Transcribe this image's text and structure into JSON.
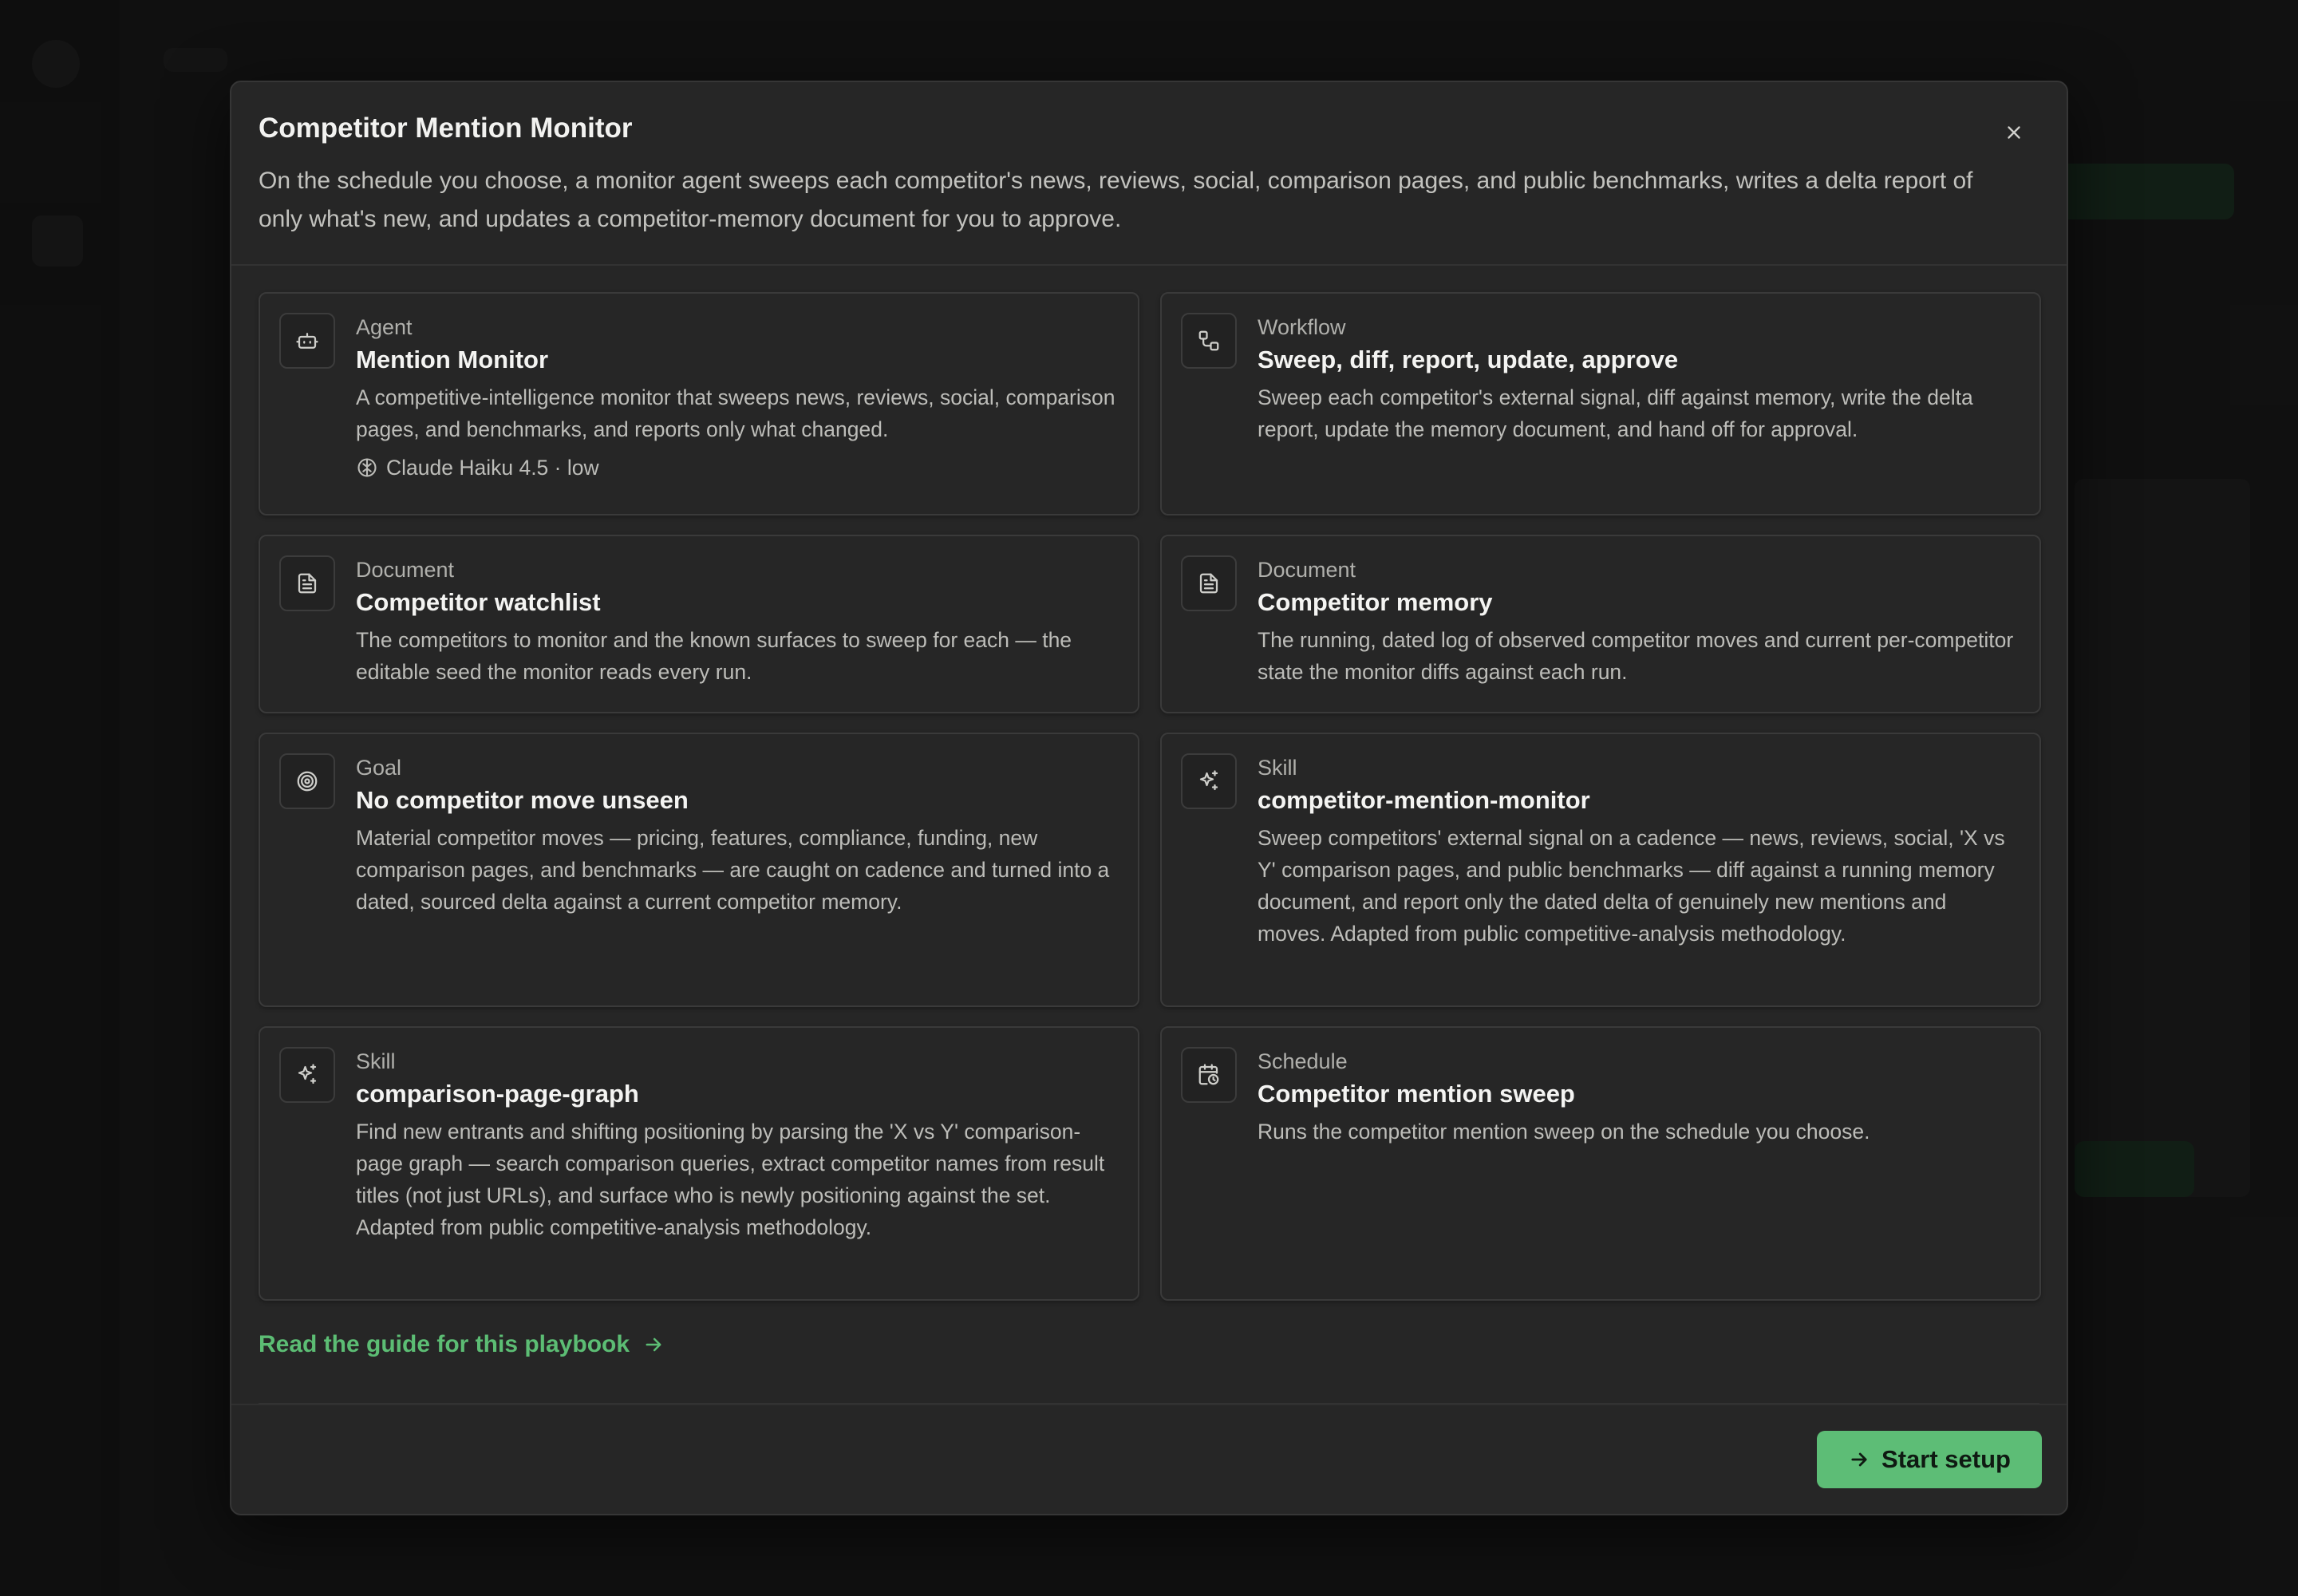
{
  "modal": {
    "title": "Competitor Mention Monitor",
    "description": "On the schedule you choose, a monitor agent sweeps each competitor's news, reviews, social, comparison pages, and public benchmarks, writes a delta report of only what's new, and updates a competitor-memory document for you to approve.",
    "close_icon": "close-icon"
  },
  "cards": {
    "agent": {
      "type": "Agent",
      "title": "Mention Monitor",
      "description": "A competitive-intelligence monitor that sweeps news, reviews, social, comparison pages, and benchmarks, and reports only what changed.",
      "model": "Claude Haiku 4.5 · low",
      "icon": "bot-icon"
    },
    "workflow": {
      "type": "Workflow",
      "title": "Sweep, diff, report, update, approve",
      "description": "Sweep each competitor's external signal, diff against memory, write the delta report, update the memory document, and hand off for approval.",
      "icon": "workflow-icon"
    },
    "watchlist": {
      "type": "Document",
      "title": "Competitor watchlist",
      "description": "The competitors to monitor and the known surfaces to sweep for each — the editable seed the monitor reads every run.",
      "icon": "document-icon"
    },
    "memory": {
      "type": "Document",
      "title": "Competitor memory",
      "description": "The running, dated log of observed competitor moves and current per-competitor state the monitor diffs against each run.",
      "icon": "document-icon"
    },
    "goal": {
      "type": "Goal",
      "title": "No competitor move unseen",
      "description": "Material competitor moves — pricing, features, compliance, funding, new comparison pages, and benchmarks — are caught on cadence and turned into a dated, sourced delta against a current competitor memory.",
      "icon": "target-icon"
    },
    "skill_monitor": {
      "type": "Skill",
      "title": "competitor-mention-monitor",
      "description": "Sweep competitors' external signal on a cadence — news, reviews, social, 'X vs Y' comparison pages, and public benchmarks — diff against a running memory document, and report only the dated delta of genuinely new mentions and moves. Adapted from public competitive-analysis methodology.",
      "icon": "sparkle-icon"
    },
    "skill_graph": {
      "type": "Skill",
      "title": "comparison-page-graph",
      "description": "Find new entrants and shifting positioning by parsing the 'X vs Y' comparison-page graph — search comparison queries, extract competitor names from result titles (not just URLs), and surface who is newly positioning against the set. Adapted from public competitive-analysis methodology.",
      "icon": "sparkle-icon"
    },
    "schedule": {
      "type": "Schedule",
      "title": "Competitor mention sweep",
      "description": "Runs the competitor mention sweep on the schedule you choose.",
      "icon": "calendar-clock-icon"
    }
  },
  "guide_link": {
    "label": "Read the guide for this playbook",
    "icon": "arrow-right-icon"
  },
  "footer": {
    "start_label": "Start setup",
    "icon": "arrow-right-icon"
  },
  "colors": {
    "accent": "#5dbd76",
    "background": "#262626",
    "border": "#3a3a3a"
  }
}
